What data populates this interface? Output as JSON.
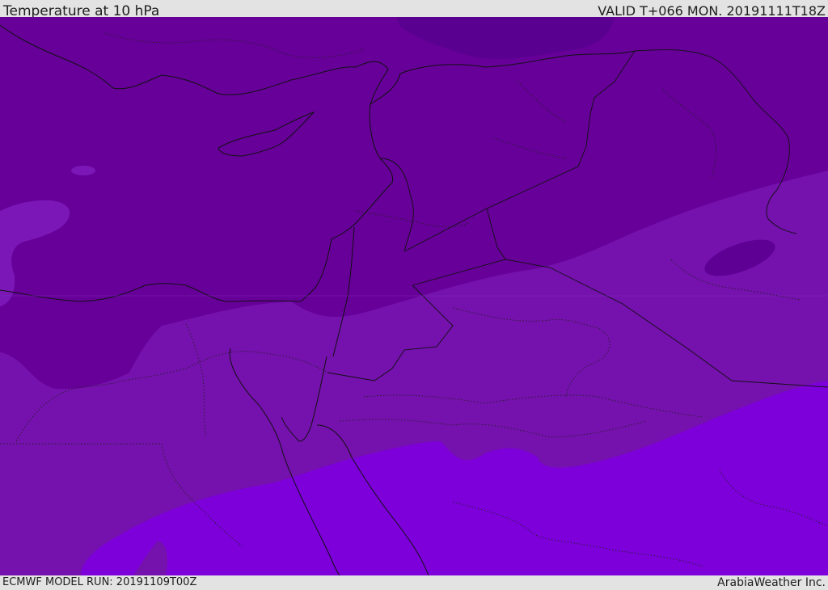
{
  "header": {
    "title": "Temperature at 10 hPa",
    "valid": "VALID T+066 MON. 20191111T18Z"
  },
  "footer": {
    "model_run": "ECMWF MODEL RUN: 20191109T00Z",
    "brand": "ArabiaWeather Inc."
  },
  "colors": {
    "darkest": "#5a0090",
    "dark": "#670099",
    "medium": "#7511ad",
    "light": "#7d00db",
    "highlight": "#7a17b6",
    "line": "#111111"
  }
}
